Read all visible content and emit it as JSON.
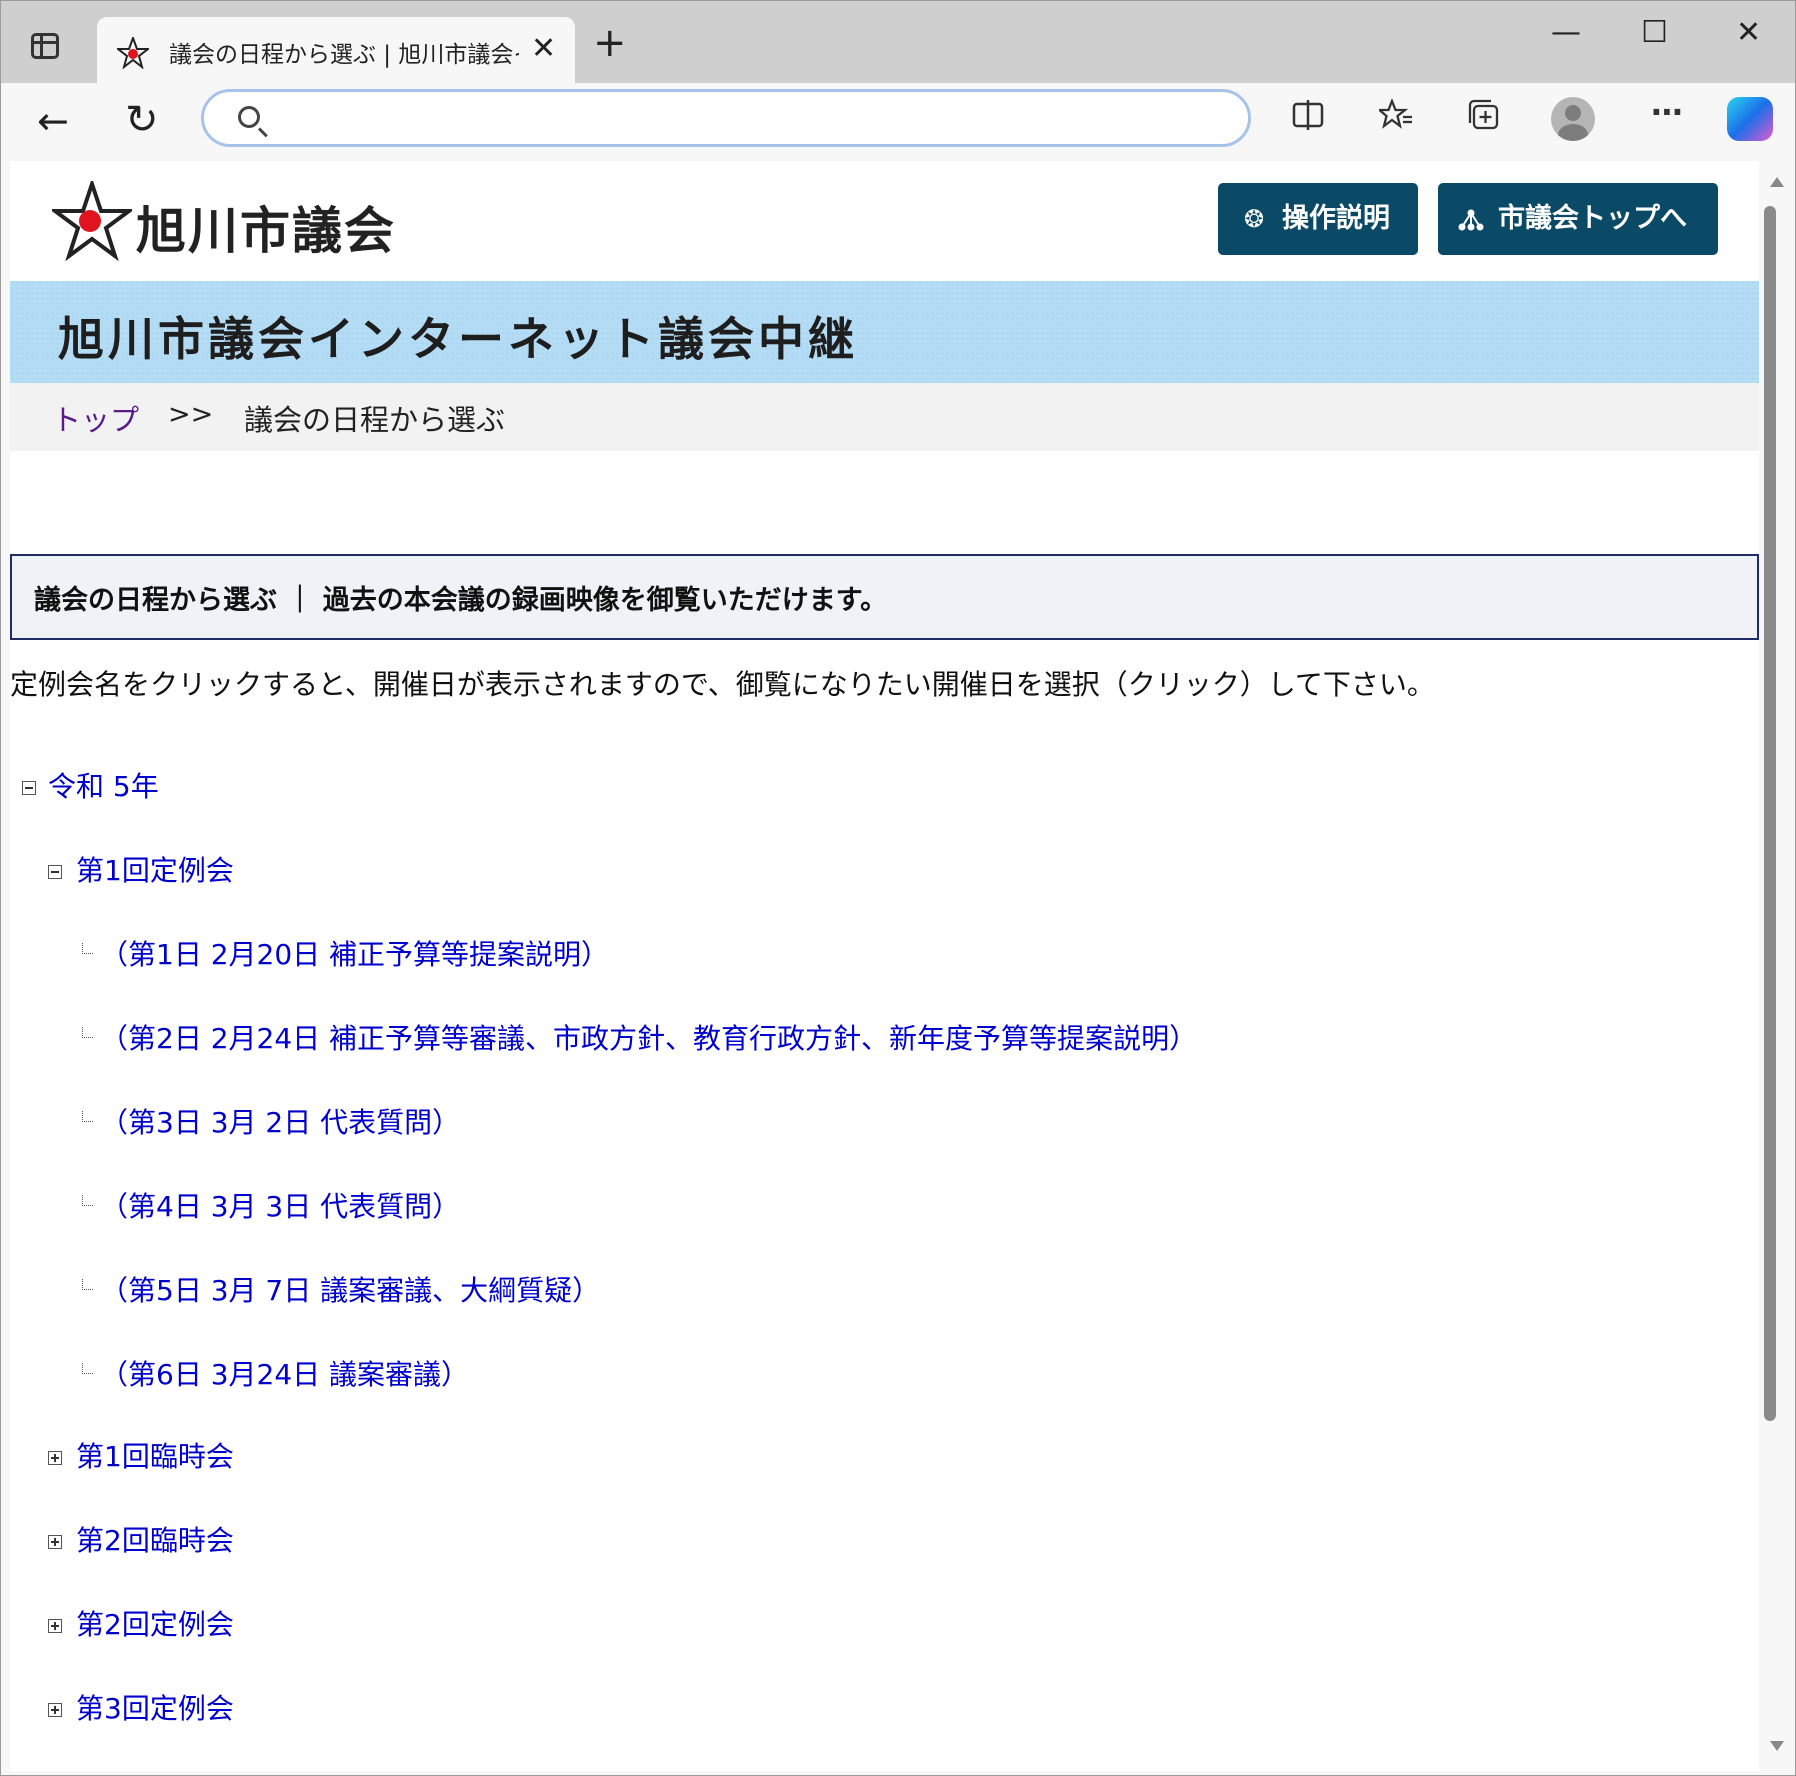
{
  "browser": {
    "tab_title": "議会の日程から選ぶ | 旭川市議会インターネット議会中継",
    "new_tab_symbol": "+",
    "tab_close_symbol": "✕",
    "window_minimize": "—",
    "window_maximize": "☐",
    "window_close": "✕",
    "address_value": ""
  },
  "header": {
    "logo_text": "旭川市議会",
    "help_button": "操作説明",
    "council_top_button": "市議会トップへ"
  },
  "banner": {
    "title": "旭川市議会インターネット議会中継"
  },
  "breadcrumb": {
    "home": "トップ",
    "separator": ">>",
    "current": "議会の日程から選ぶ"
  },
  "section": {
    "heading": "議会の日程から選ぶ ｜ 過去の本会議の録画映像を御覧いただけます。"
  },
  "instruction": "定例会名をクリックすると、開催日が表示されますので、御覧になりたい開催日を選択（クリック）して下さい。",
  "tree": {
    "year": "令和 5年",
    "sessions": [
      {
        "label": "第1回定例会",
        "days": [
          "（第1日 2月20日 補正予算等提案説明）",
          "（第2日 2月24日 補正予算等審議、市政方針、教育行政方針、新年度予算等提案説明）",
          "（第3日 3月 2日 代表質問）",
          "（第4日 3月 3日 代表質問）",
          "（第5日 3月 7日 議案審議、大綱質疑）",
          "（第6日 3月24日 議案審議）"
        ]
      },
      {
        "label": "第1回臨時会"
      },
      {
        "label": "第2回臨時会"
      },
      {
        "label": "第2回定例会"
      },
      {
        "label": "第3回定例会"
      }
    ]
  },
  "colors": {
    "link": "#0000cc",
    "visited_link": "#5b1a8a",
    "header_button": "#0b4a66",
    "banner": "#b5dcf5",
    "section_border": "#1f2d66"
  },
  "icons": {
    "favicon": "star-logo-icon",
    "help": "gear-icon",
    "council_top": "sitemap-icon",
    "back": "arrow-left-icon",
    "reload": "reload-icon",
    "split": "split-screen-icon",
    "favorites": "favorites-star-icon",
    "collections": "collections-icon",
    "more": "more-dots-icon"
  }
}
